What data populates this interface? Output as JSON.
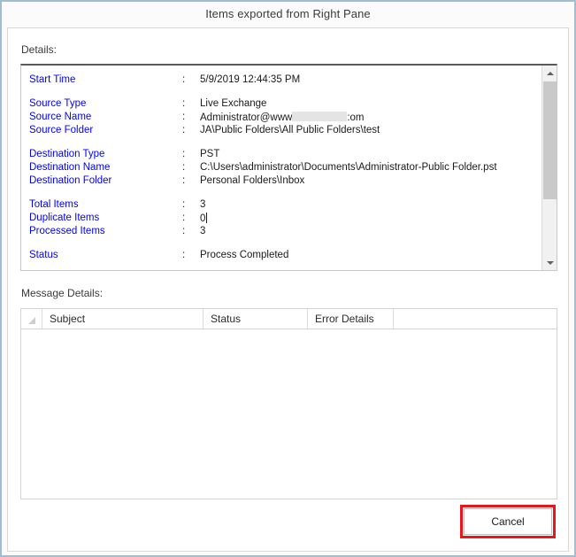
{
  "window": {
    "title": "Items exported from Right Pane",
    "border_color": "#9fbdd6"
  },
  "details_section": {
    "label": "Details:",
    "rows": [
      {
        "label": "Start Time",
        "separator": ":",
        "value": "5/9/2019 12:44:35 PM"
      },
      {
        "label": "Source Type",
        "separator": ":",
        "value": "Live Exchange"
      },
      {
        "label": "Source Name",
        "separator": ":",
        "value_prefix": "Administrator@www",
        "redacted": true,
        "value_suffix": ":om"
      },
      {
        "label": "Source Folder",
        "separator": ":",
        "value": "JA\\Public Folders\\All Public Folders\\test"
      },
      {
        "label": "Destination Type",
        "separator": ":",
        "value": "PST"
      },
      {
        "label": "Destination Name",
        "separator": ":",
        "value": "C:\\Users\\administrator\\Documents\\Administrator-Public Folder.pst"
      },
      {
        "label": "Destination Folder",
        "separator": ":",
        "value": "Personal Folders\\Inbox"
      },
      {
        "label": "Total Items",
        "separator": ":",
        "value": "3"
      },
      {
        "label": "Duplicate Items",
        "separator": ":",
        "value": "0",
        "caret": true
      },
      {
        "label": "Processed Items",
        "separator": ":",
        "value": "3"
      },
      {
        "label": "Status",
        "separator": ":",
        "value": "Process Completed"
      }
    ],
    "label_color": "#0000ff",
    "value_color": "#1a1a1a"
  },
  "scrollbar": {
    "up_arrow": "chevron-up-icon",
    "down_arrow": "chevron-down-icon"
  },
  "message_section": {
    "label": "Message Details:",
    "columns": [
      "Subject",
      "Status",
      "Error Details"
    ],
    "rows": []
  },
  "footer": {
    "cancel_label": "Cancel",
    "annotation_color": "#e8151b"
  }
}
